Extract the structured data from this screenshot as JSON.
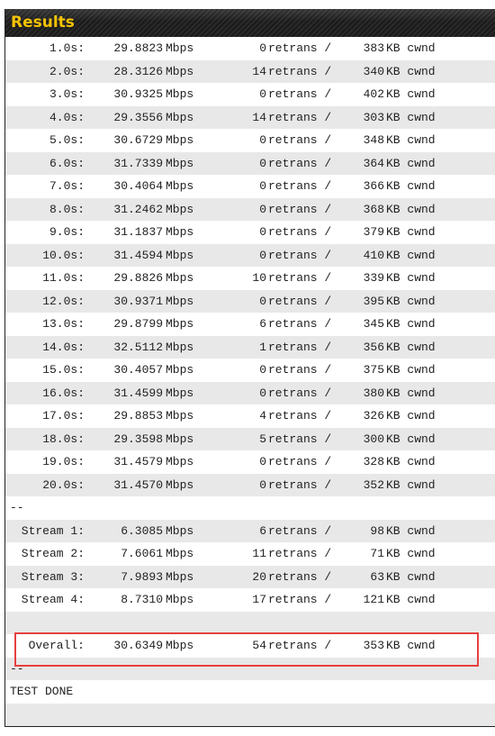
{
  "header": {
    "title": "Results"
  },
  "units": {
    "rate": "Mbps",
    "retrans": "retrans /",
    "cwnd": "KB cwnd"
  },
  "intervals": [
    [
      "1.0s:",
      "29.8823",
      "0",
      "383"
    ],
    [
      "2.0s:",
      "28.3126",
      "14",
      "340"
    ],
    [
      "3.0s:",
      "30.9325",
      "0",
      "402"
    ],
    [
      "4.0s:",
      "29.3556",
      "14",
      "303"
    ],
    [
      "5.0s:",
      "30.6729",
      "0",
      "348"
    ],
    [
      "6.0s:",
      "31.7339",
      "0",
      "364"
    ],
    [
      "7.0s:",
      "30.4064",
      "0",
      "366"
    ],
    [
      "8.0s:",
      "31.2462",
      "0",
      "368"
    ],
    [
      "9.0s:",
      "31.1837",
      "0",
      "379"
    ],
    [
      "10.0s:",
      "31.4594",
      "0",
      "410"
    ],
    [
      "11.0s:",
      "29.8826",
      "10",
      "339"
    ],
    [
      "12.0s:",
      "30.9371",
      "0",
      "395"
    ],
    [
      "13.0s:",
      "29.8799",
      "6",
      "345"
    ],
    [
      "14.0s:",
      "32.5112",
      "1",
      "356"
    ],
    [
      "15.0s:",
      "30.4057",
      "0",
      "375"
    ],
    [
      "16.0s:",
      "31.4599",
      "0",
      "380"
    ],
    [
      "17.0s:",
      "29.8853",
      "4",
      "326"
    ],
    [
      "18.0s:",
      "29.3598",
      "5",
      "300"
    ],
    [
      "19.0s:",
      "31.4579",
      "0",
      "328"
    ],
    [
      "20.0s:",
      "31.4570",
      "0",
      "352"
    ]
  ],
  "separator": "--",
  "streams": [
    [
      "Stream 1:",
      "6.3085",
      "6",
      "98"
    ],
    [
      "Stream 2:",
      "7.6061",
      "11",
      "71"
    ],
    [
      "Stream 3:",
      "7.9893",
      "20",
      "63"
    ],
    [
      "Stream 4:",
      "8.7310",
      "17",
      "121"
    ]
  ],
  "overall": [
    "Overall:",
    "30.6349",
    "54",
    "353"
  ],
  "done": "TEST DONE",
  "colors": {
    "title": "#f5c200",
    "highlight": "#e8403f",
    "stripe": "#e8e8e8"
  }
}
